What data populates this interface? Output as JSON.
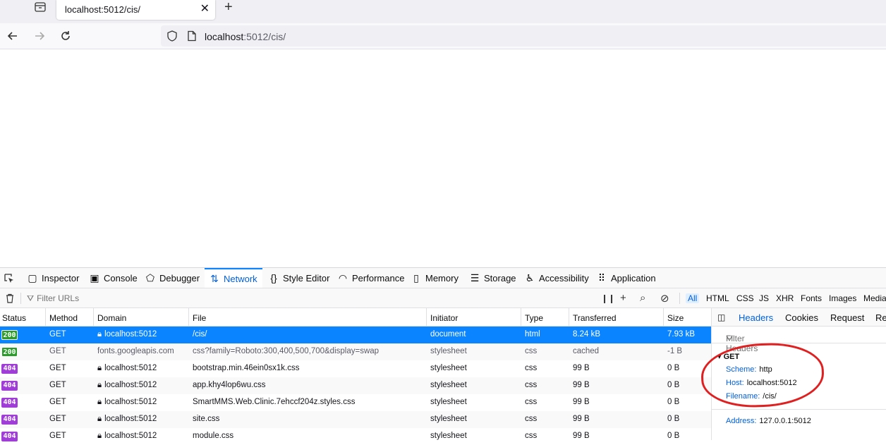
{
  "browser": {
    "tab_title": "localhost:5012/cis/",
    "tab_close": "✕",
    "new_tab": "+",
    "url_host": "localhost",
    "url_rest": ":5012/cis/"
  },
  "devtools": {
    "tools": [
      "Inspector",
      "Console",
      "Debugger",
      "Network",
      "Style Editor",
      "Performance",
      "Memory",
      "Storage",
      "Accessibility",
      "Application"
    ],
    "active_tool": "Network",
    "filter_placeholder": "Filter URLs",
    "type_filters": [
      "All",
      "HTML",
      "CSS",
      "JS",
      "XHR",
      "Fonts",
      "Images",
      "Media"
    ],
    "columns": [
      "Status",
      "Method",
      "Domain",
      "File",
      "Initiator",
      "Type",
      "Transferred",
      "Size"
    ],
    "requests": [
      {
        "status": "200",
        "method": "GET",
        "domain": "localhost:5012",
        "file": "/cis/",
        "initiator": "document",
        "type": "html",
        "transferred": "8.24 kB",
        "size": "7.93 kB"
      },
      {
        "status": "200",
        "method": "GET",
        "domain": "fonts.googleapis.com",
        "file": "css?family=Roboto:300,400,500,700&display=swap",
        "initiator": "stylesheet",
        "type": "css",
        "transferred": "cached",
        "size": "-1 B"
      },
      {
        "status": "404",
        "method": "GET",
        "domain": "localhost:5012",
        "file": "bootstrap.min.46ein0sx1k.css",
        "initiator": "stylesheet",
        "type": "css",
        "transferred": "99 B",
        "size": "0 B"
      },
      {
        "status": "404",
        "method": "GET",
        "domain": "localhost:5012",
        "file": "app.khy4lop6wu.css",
        "initiator": "stylesheet",
        "type": "css",
        "transferred": "99 B",
        "size": "0 B"
      },
      {
        "status": "404",
        "method": "GET",
        "domain": "localhost:5012",
        "file": "SmartMMS.Web.Clinic.7ehccf204z.styles.css",
        "initiator": "stylesheet",
        "type": "css",
        "transferred": "99 B",
        "size": "0 B"
      },
      {
        "status": "404",
        "method": "GET",
        "domain": "localhost:5012",
        "file": "site.css",
        "initiator": "stylesheet",
        "type": "css",
        "transferred": "99 B",
        "size": "0 B"
      },
      {
        "status": "404",
        "method": "GET",
        "domain": "localhost:5012",
        "file": "module.css",
        "initiator": "stylesheet",
        "type": "css",
        "transferred": "99 B",
        "size": "0 B"
      }
    ],
    "side_tabs": [
      "Headers",
      "Cookies",
      "Request",
      "Res"
    ],
    "side_filter": "Filter Headers",
    "get_label": "GET",
    "scheme_k": "Scheme:",
    "scheme_v": "http",
    "host_k": "Host:",
    "host_v": "localhost:5012",
    "filename_k": "Filename:",
    "filename_v": "/cis/",
    "address_k": "Address:",
    "address_v": "127.0.0.1:5012",
    "accent_color": "#0a84ff",
    "annotation_color": "#e02020"
  }
}
